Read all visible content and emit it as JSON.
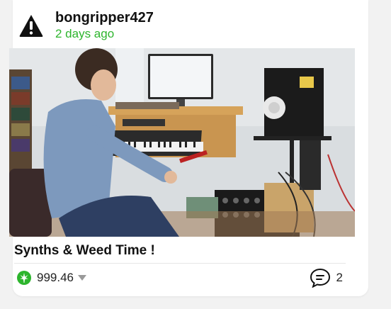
{
  "post": {
    "username": "bongripper427",
    "timestamp": "2 days ago",
    "title": "Synths & Weed Time !",
    "score": "999.46",
    "comment_count": "2",
    "avatar_icon": "warning-triangle-icon",
    "score_icon": "cannabis-leaf-icon",
    "vote_icon": "caret-down-icon",
    "comment_icon": "comment-bubble-icon"
  },
  "colors": {
    "accent_green": "#2db52d",
    "text_dark": "#111111"
  }
}
